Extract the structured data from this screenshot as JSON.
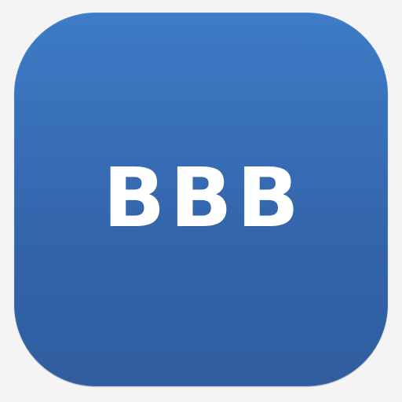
{
  "app_icon": {
    "label": "BBB",
    "colors": {
      "background_top": "#3d7cc6",
      "background_bottom": "#2f5d9f",
      "text": "#ffffff",
      "page": "#f4f4f4"
    }
  }
}
